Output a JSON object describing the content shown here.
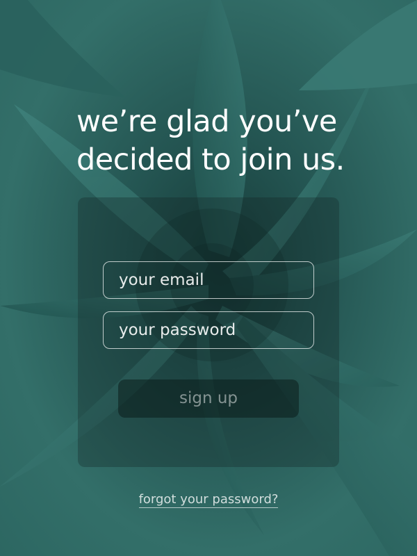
{
  "signup_page": {
    "headline_line1": "we’re glad you’ve",
    "headline_line2": "decided to join us.",
    "email_placeholder": "your email",
    "password_placeholder": "your password",
    "signup_label": "sign up",
    "forgot_link": "forgot your password?"
  },
  "colors": {
    "background": "#2f6b66",
    "text": "#ffffff"
  }
}
